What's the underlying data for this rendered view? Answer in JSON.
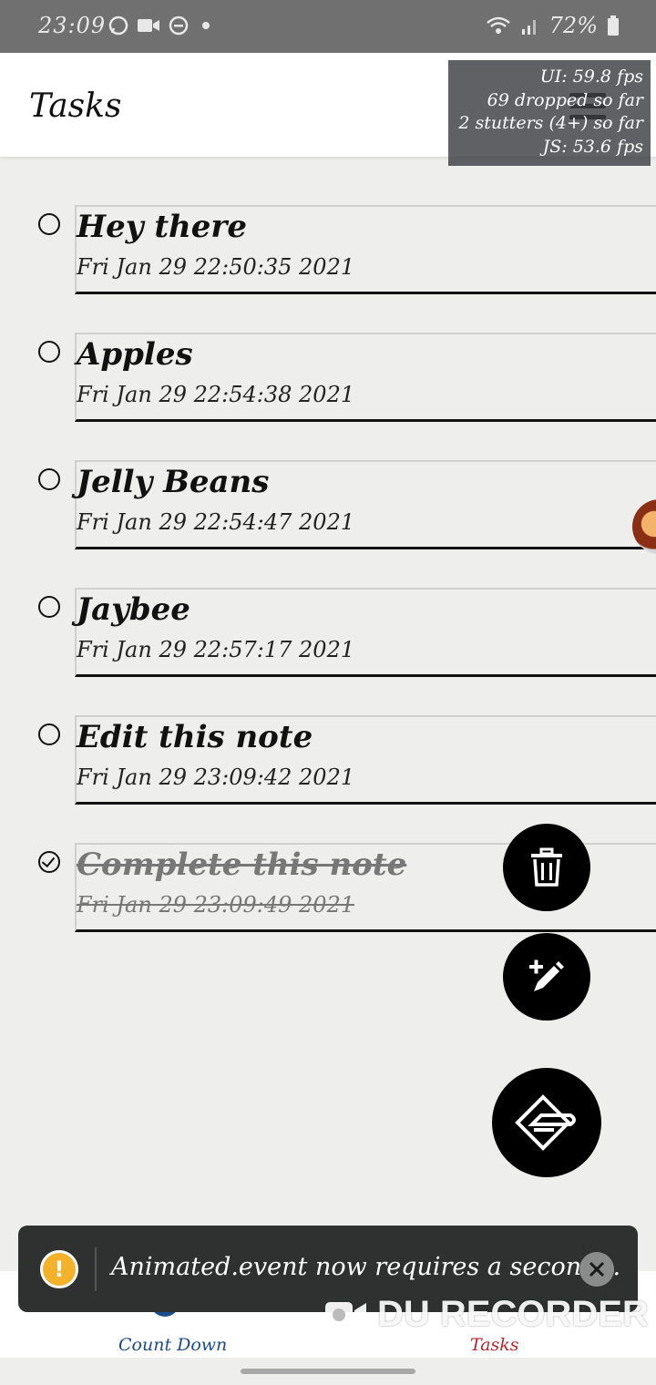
{
  "status_bar": {
    "time": "23:09",
    "battery": "72%"
  },
  "header": {
    "title": "Tasks"
  },
  "perf_monitor": {
    "ui_fps": "UI: 59.8 fps",
    "dropped": "69 dropped so far",
    "stutters": "2 stutters (4+) so far",
    "js_fps": "JS: 53.6 fps"
  },
  "tasks": [
    {
      "title": "Hey there",
      "date": "Fri Jan 29 22:50:35 2021",
      "completed": false
    },
    {
      "title": "Apples",
      "date": "Fri Jan 29 22:54:38 2021",
      "completed": false
    },
    {
      "title": "Jelly Beans",
      "date": "Fri Jan 29 22:54:47 2021",
      "completed": false
    },
    {
      "title": "Jaybee",
      "date": "Fri Jan 29 22:57:17 2021",
      "completed": false
    },
    {
      "title": "Edit this note",
      "date": "Fri Jan 29 23:09:42 2021",
      "completed": false
    },
    {
      "title": "Complete this note",
      "date": "Fri Jan 29 23:09:49 2021",
      "completed": true
    }
  ],
  "snackbar": {
    "message": "Animated.event now requires a second..."
  },
  "tabs": [
    {
      "label": "Count Down",
      "active": false
    },
    {
      "label": "Tasks",
      "active": true
    }
  ],
  "watermark": "DU RECORDER",
  "colors": {
    "tab_active": "#b8262c",
    "tab_inactive": "#1a4c8c",
    "warning": "#f4b22a"
  }
}
